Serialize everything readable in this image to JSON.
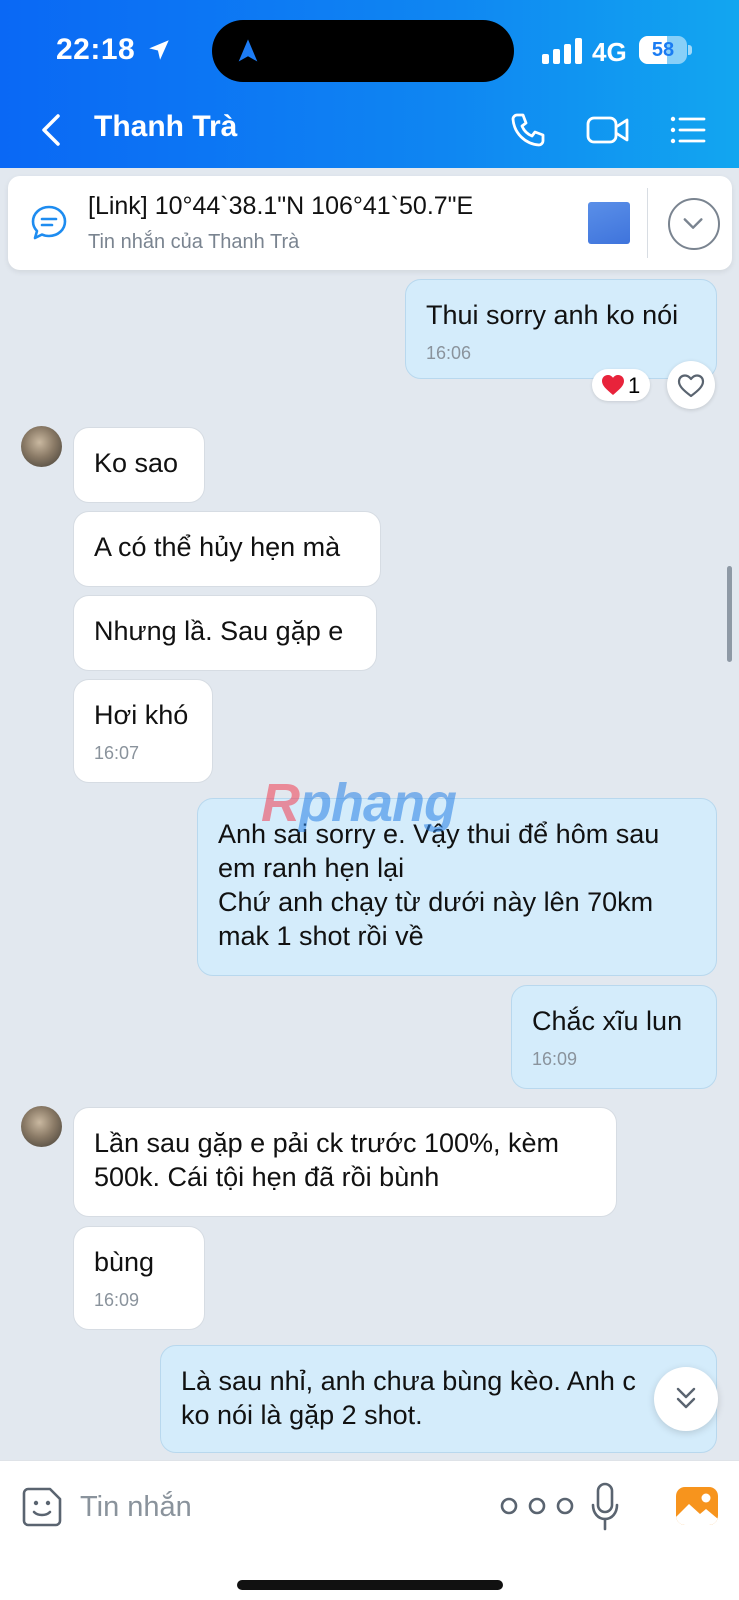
{
  "status_bar": {
    "time": "22:18",
    "network": "4G",
    "battery": "58"
  },
  "header": {
    "title": "Thanh Trà"
  },
  "pinned": {
    "title": "[Link] 10°44`38.1\"N 106°41`50.7\"E",
    "subtitle": "Tin nhắn của Thanh Trà"
  },
  "messages": [
    {
      "dir": "out",
      "text": "Thui sorry anh ko nói",
      "time": "16:06"
    },
    {
      "dir": "in",
      "text": "Ko sao",
      "time": ""
    },
    {
      "dir": "in",
      "text": "A có thể hủy hẹn mà",
      "time": ""
    },
    {
      "dir": "in",
      "text": "Nhưng lầ. Sau gặp e",
      "time": ""
    },
    {
      "dir": "in",
      "text": "Hơi khó",
      "time": "16:07"
    },
    {
      "dir": "out",
      "text": "Anh sai sorry e. Vậy thui để hôm sau\nem ranh hẹn lại\nChứ anh chạy từ dưới này lên 70km\nmak 1 shot rồi về",
      "time": ""
    },
    {
      "dir": "out",
      "text": "Chắc xĩu lun",
      "time": "16:09"
    },
    {
      "dir": "in",
      "text": "Lần sau gặp e pải ck trước 100%, kèm\n500k. Cái tội hẹn đã rồi bùnh",
      "time": ""
    },
    {
      "dir": "in",
      "text": "bùng",
      "time": "16:09"
    },
    {
      "dir": "out",
      "text": "Là sau nhỉ, anh chưa bùng kèo. Anh c\nko nói là gặp 2 shot.",
      "time": ""
    }
  ],
  "reaction": {
    "emoji": "heart",
    "count": "1"
  },
  "watermark": {
    "text_first": "R",
    "text_rest": "phang"
  },
  "composer": {
    "placeholder": "Tin nhắn"
  },
  "icons": {
    "back": "chevron-left-icon",
    "call": "phone-icon",
    "video": "video-camera-icon",
    "menu": "list-menu-icon",
    "pinned": "chat-bubble-icon",
    "expand": "chevron-down-icon",
    "like": "heart-outline-icon",
    "scroll": "double-chevron-down-icon",
    "sticker": "sticker-face-icon",
    "more": "more-dots-icon",
    "mic": "microphone-icon",
    "image": "image-icon"
  },
  "colors": {
    "header_start": "#0a68f5",
    "header_end": "#12a6f0",
    "incoming_bubble": "#ffffff",
    "outgoing_bubble": "#d4ecfb",
    "chat_background": "#e2e8ef",
    "reaction_heart": "#e8233b"
  }
}
